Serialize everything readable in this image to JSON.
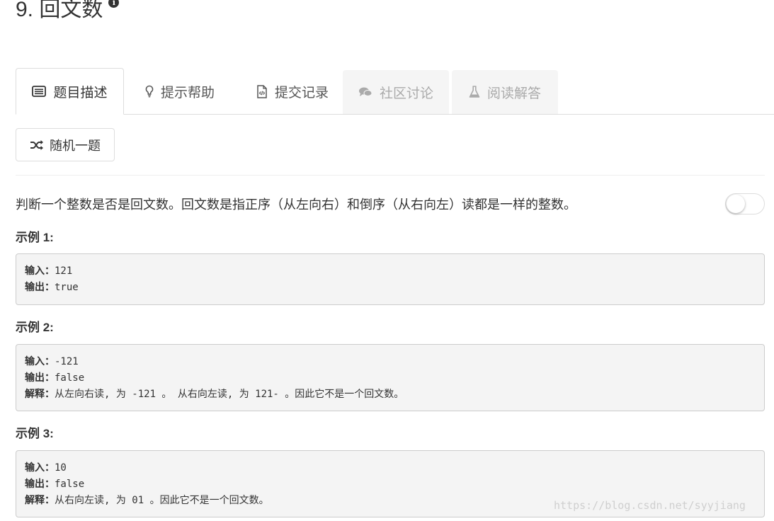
{
  "problem": {
    "title": "9. 回文数",
    "info_icon": "info-circle-icon"
  },
  "tabs": [
    {
      "label": "题目描述",
      "icon": "list-alt-icon",
      "state": "active"
    },
    {
      "label": "提示帮助",
      "icon": "lightbulb-icon",
      "state": "normal"
    },
    {
      "label": "提交记录",
      "icon": "file-code-icon",
      "state": "normal"
    },
    {
      "label": "社区讨论",
      "icon": "comments-icon",
      "state": "disabled"
    },
    {
      "label": "阅读解答",
      "icon": "flask-icon",
      "state": "disabled"
    }
  ],
  "random_button": {
    "label": "随机一题",
    "icon": "shuffle-icon"
  },
  "description": "判断一个整数是否是回文数。回文数是指正序（从左向右）和倒序（从右向左）读都是一样的整数。",
  "examples": [
    {
      "title": "示例 1:",
      "input_label": "输入：",
      "input": "121",
      "output_label": "输出：",
      "output": "true"
    },
    {
      "title": "示例 2:",
      "input_label": "输入：",
      "input": "-121",
      "output_label": "输出：",
      "output": "false",
      "explain_label": "解释：",
      "explain": "从左向右读, 为 -121 。 从右向左读, 为 121- 。因此它不是一个回文数。"
    },
    {
      "title": "示例 3:",
      "input_label": "输入：",
      "input": "10",
      "output_label": "输出：",
      "output": "false",
      "explain_label": "解释：",
      "explain": "从右向左读, 为 01 。因此它不是一个回文数。"
    }
  ],
  "watermark": "https://blog.csdn.net/syyjiang",
  "colors": {
    "text": "#333333",
    "border": "#dddddd",
    "code_bg": "#f4f4f4",
    "disabled_tab_bg": "#f5f5f5",
    "disabled_text": "#aaaaaa"
  }
}
